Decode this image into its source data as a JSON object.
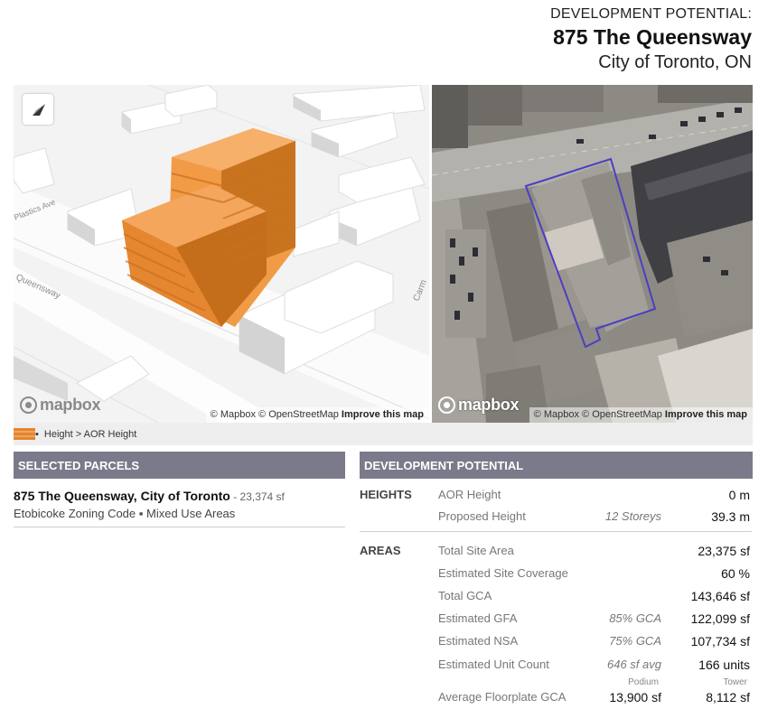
{
  "header": {
    "line1": "DEVELOPMENT POTENTIAL:",
    "address": "875 The Queensway",
    "city": "City of Toronto, ON"
  },
  "map3d": {
    "labels": {
      "street1": "Plastics Ave",
      "street2": "Queensway",
      "street3": "Carm"
    },
    "logo": "mapbox",
    "attribution": {
      "mapbox": "© Mapbox",
      "osm": "© OpenStreetMap",
      "improve": "Improve this map"
    },
    "icons": {
      "compass": "compass-icon"
    }
  },
  "mapsat": {
    "logo": "mapbox",
    "attribution": {
      "mapbox": "© Mapbox",
      "osm": "© OpenStreetMap",
      "improve": "Improve this map"
    }
  },
  "legend": {
    "text": "Height > AOR Height"
  },
  "colors": {
    "accent_orange": "#e28632",
    "section_bar": "#7b7a8b",
    "parcel_outline": "#4a3fc4"
  },
  "selected_parcels": {
    "title": "SELECTED PARCELS",
    "name": "875 The Queensway, City of Toronto",
    "area": " - 23,374 sf",
    "zoning": "Etobicoke Zoning Code",
    "use": "Mixed Use Areas"
  },
  "development": {
    "title": "DEVELOPMENT POTENTIAL",
    "heights": {
      "label": "HEIGHTS",
      "aor_label": "AOR Height",
      "aor_value": "0 m",
      "proposed_label": "Proposed Height",
      "proposed_note": "12 Storeys",
      "proposed_value": "39.3 m"
    },
    "areas": {
      "label": "AREAS",
      "site_label": "Total Site Area",
      "site_value": "23,375 sf",
      "coverage_label": "Estimated Site Coverage",
      "coverage_value": "60 %",
      "gca_label": "Total GCA",
      "gca_value": "143,646 sf",
      "gfa_label": "Estimated GFA",
      "gfa_note": "85% GCA",
      "gfa_value": "122,099 sf",
      "nsa_label": "Estimated NSA",
      "nsa_note": "75% GCA",
      "nsa_value": "107,734 sf",
      "units_label": "Estimated Unit Count",
      "units_note": "646 sf avg",
      "units_value": "166 units",
      "floor_label": "Average Floorplate GCA",
      "podium_label": "Podium",
      "podium_value": "13,900 sf",
      "tower_label": "Tower",
      "tower_value": "8,112 sf"
    }
  }
}
